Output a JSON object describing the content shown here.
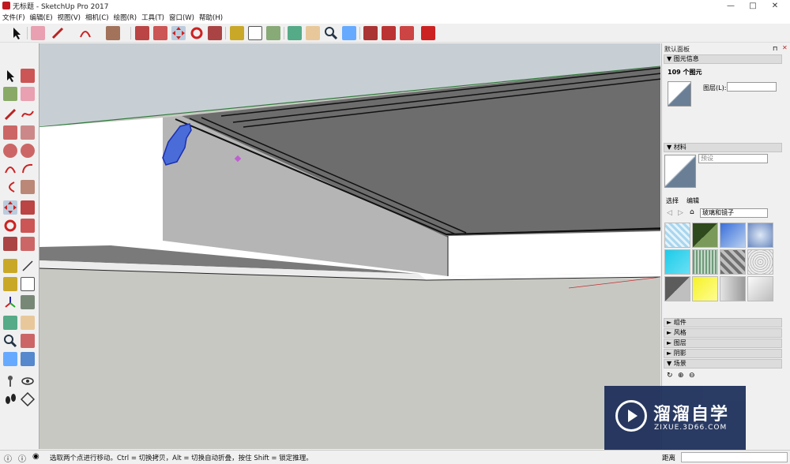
{
  "window": {
    "title": "无标题 - SketchUp Pro 2017",
    "minimize": "—",
    "maximize": "□",
    "close": "✕"
  },
  "menu": [
    "文件(F)",
    "编辑(E)",
    "视图(V)",
    "相机(C)",
    "绘图(R)",
    "工具(T)",
    "窗口(W)",
    "帮助(H)"
  ],
  "colors": {
    "accent": "#c0181e",
    "viewport_bg": "#c8c8c3",
    "watermark_bg": "#1b2d59"
  },
  "tray": {
    "title": "默认面板",
    "entity_info": {
      "header": "图元信息",
      "count": "109 个图元",
      "layer_label": "图层(L):",
      "layer_value": ""
    },
    "materials": {
      "header": "材料",
      "material_name": "预设",
      "tab_select": "选择",
      "tab_edit": "编辑",
      "library": "玻璃和镜子"
    },
    "collapsed": [
      "组件",
      "风格",
      "图层",
      "阴影"
    ],
    "scenes": {
      "header": "场景"
    }
  },
  "status": {
    "message": "选取两个点进行移动。Ctrl = 切换拷贝，Alt = 切换自动折叠，按住 Shift = 锁定推理。",
    "measure_label": "距离"
  },
  "watermark": {
    "main": "溜溜自学",
    "sub": "ZIXUE.3D66.COM"
  }
}
